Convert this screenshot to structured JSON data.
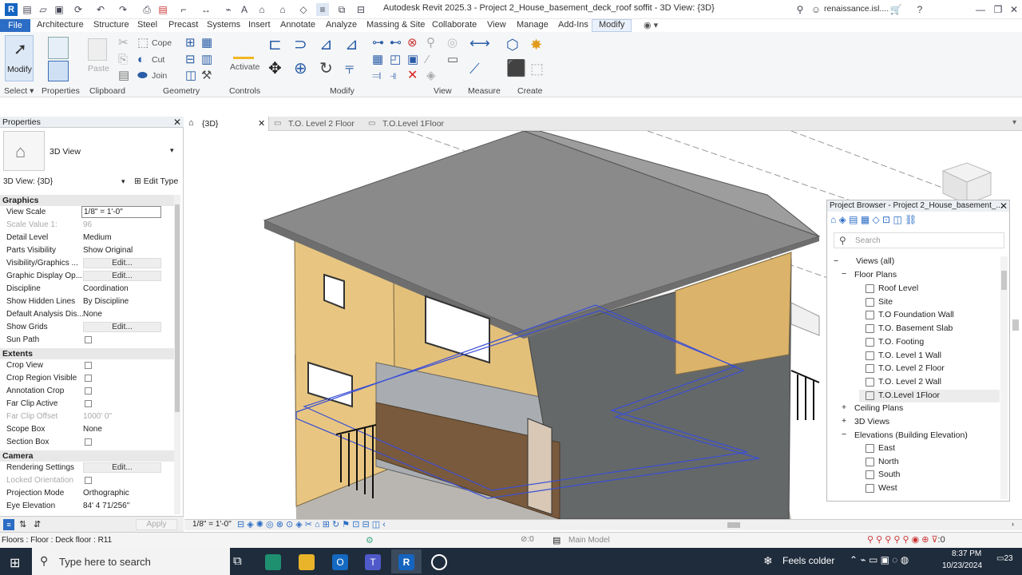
{
  "window": {
    "title": "Autodesk Revit 2025.3 - Project 2_House_basement_deck_roof soffit - 3D View: {3D}",
    "user": "renaissance.isl...."
  },
  "tabs": [
    "File",
    "Architecture",
    "Structure",
    "Steel",
    "Systems",
    "Precast",
    "Insert",
    "Annotate",
    "Analyze",
    "Massing & Site",
    "Collaborate",
    "View",
    "Manage",
    "Add-Ins",
    "Modify"
  ],
  "ribbon": {
    "select_label": "Select",
    "modify_label": "Modify",
    "panels": [
      "Properties",
      "Clipboard",
      "Geometry",
      "Controls",
      "Modify",
      "View",
      "Measure",
      "Create"
    ],
    "paste": "Paste",
    "cope": "Cope",
    "cut": "Cut",
    "join": "Join",
    "activate": "Activate"
  },
  "properties": {
    "title": "Properties",
    "type_name": "3D View",
    "selector": "3D View: {3D}",
    "edit_type": "Edit Type",
    "sections": {
      "graphics": "Graphics",
      "extents": "Extents",
      "camera": "Camera"
    },
    "rows": [
      {
        "name": "View Scale",
        "value": "1/8\" = 1'-0\""
      },
      {
        "name": "Scale Value    1:",
        "value": "96"
      },
      {
        "name": "Detail Level",
        "value": "Medium"
      },
      {
        "name": "Parts Visibility",
        "value": "Show Original"
      },
      {
        "name": "Visibility/Graphics ...",
        "value": "Edit..."
      },
      {
        "name": "Graphic Display Op...",
        "value": "Edit..."
      },
      {
        "name": "Discipline",
        "value": "Coordination"
      },
      {
        "name": "Show Hidden Lines",
        "value": "By Discipline"
      },
      {
        "name": "Default Analysis Dis...",
        "value": "None"
      },
      {
        "name": "Show Grids",
        "value": "Edit..."
      },
      {
        "name": "Sun Path",
        "value": ""
      },
      {
        "name": "Crop View",
        "value": ""
      },
      {
        "name": "Crop Region Visible",
        "value": ""
      },
      {
        "name": "Annotation Crop",
        "value": ""
      },
      {
        "name": "Far Clip Active",
        "value": ""
      },
      {
        "name": "Far Clip Offset",
        "value": "1000'  0\""
      },
      {
        "name": "Scope Box",
        "value": "None"
      },
      {
        "name": "Section Box",
        "value": ""
      },
      {
        "name": "Rendering Settings",
        "value": "Edit..."
      },
      {
        "name": "Locked Orientation",
        "value": ""
      },
      {
        "name": "Projection Mode",
        "value": "Orthographic"
      },
      {
        "name": "Eye Elevation",
        "value": "84'  4 71/256\""
      }
    ],
    "apply": "Apply"
  },
  "view_tabs": [
    "{3D}",
    "T.O. Level 2 Floor",
    "T.O.Level 1Floor"
  ],
  "project_browser": {
    "title": "Project Browser - Project 2_House_basement_...",
    "search_placeholder": "Search",
    "tree": {
      "root": "Views (all)",
      "floor_plans": "Floor Plans",
      "floor_items": [
        "Roof Level",
        "Site",
        "T.O Foundation Wall",
        "T.O. Basement Slab",
        "T.O. Footing",
        "T.O. Level 1 Wall",
        "T.O. Level 2 Floor",
        "T.O. Level 2 Wall",
        "T.O.Level 1Floor"
      ],
      "ceiling": "Ceiling Plans",
      "views3d": "3D Views",
      "elev": "Elevations (Building Elevation)",
      "elev_items": [
        "East",
        "North",
        "South",
        "West"
      ]
    }
  },
  "view_control": {
    "scale": "1/8\" = 1'-0\""
  },
  "status": {
    "text": "Floors : Floor : Deck floor : R11",
    "model": "Main Model",
    "filter": ":0",
    "sel": ":0"
  },
  "taskbar": {
    "search": "Type here to search",
    "weather": "Feels colder",
    "time": "8:37 PM",
    "date": "10/23/2024",
    "notif": "23"
  },
  "colors": {
    "accent": "#2b6cc4",
    "siding": "#e8c681",
    "roof": "#8a8a8a",
    "brick": "#6b6d6e",
    "deck": "#7a5a3c"
  }
}
